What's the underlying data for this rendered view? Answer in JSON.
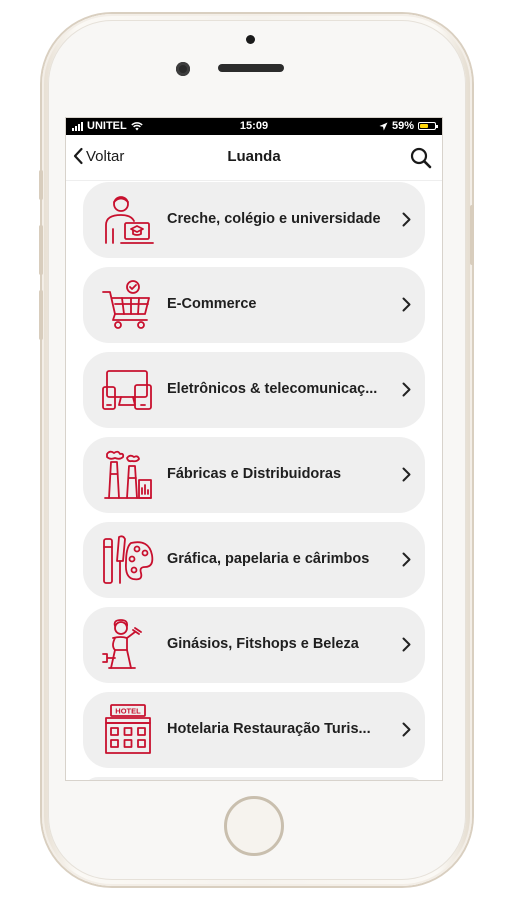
{
  "status_bar": {
    "carrier": "UNITEL",
    "time": "15:09",
    "battery": "59%",
    "battery_level": 0.59
  },
  "nav": {
    "back_label": "Voltar",
    "title": "Luanda"
  },
  "colors": {
    "accent": "#c8102e",
    "card": "#efefef"
  },
  "categories": [
    {
      "label": "Creche, colégio e universidade",
      "icon": "graduate-icon"
    },
    {
      "label": "E-Commerce",
      "icon": "shopping-cart-icon"
    },
    {
      "label": "Eletrônicos & telecomunicaç...",
      "icon": "devices-icon"
    },
    {
      "label": "Fábricas e Distribuidoras",
      "icon": "factory-icon"
    },
    {
      "label": "Gráfica, papelaria e cârimbos",
      "icon": "palette-icon"
    },
    {
      "label": "Ginásios, Fitshops e Beleza",
      "icon": "fitness-icon"
    },
    {
      "label": "Hotelaria Restauração Turis...",
      "icon": "hotel-icon",
      "icon_text": "HOTEL"
    }
  ]
}
